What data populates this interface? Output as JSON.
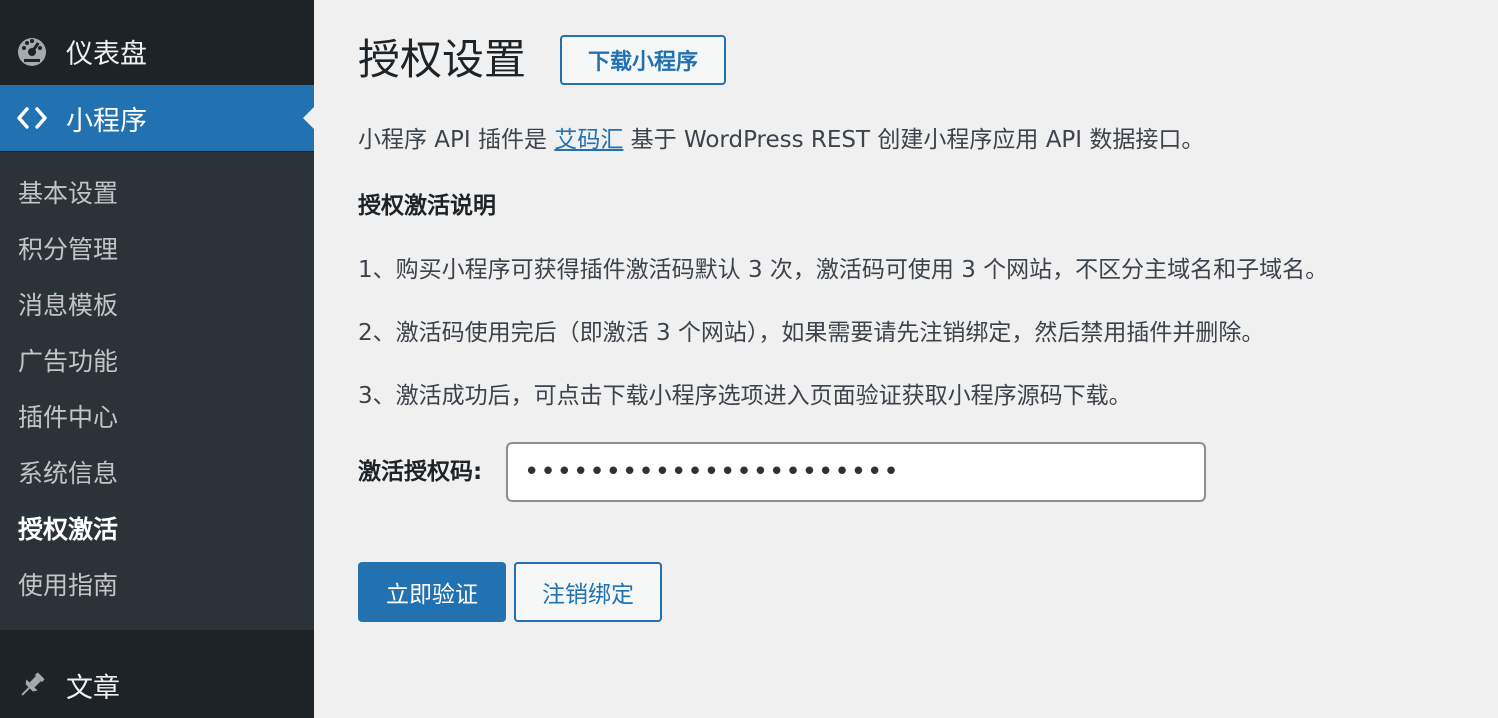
{
  "sidebar": {
    "dashboard_label": "仪表盘",
    "miniprogram_label": "小程序",
    "posts_label": "文章",
    "submenu": [
      {
        "label": "基本设置"
      },
      {
        "label": "积分管理"
      },
      {
        "label": "消息模板"
      },
      {
        "label": "广告功能"
      },
      {
        "label": "插件中心"
      },
      {
        "label": "系统信息"
      },
      {
        "label": "授权激活",
        "current": true
      },
      {
        "label": "使用指南"
      }
    ]
  },
  "header": {
    "title": "授权设置",
    "action_label": "下载小程序"
  },
  "intro": {
    "before": "小程序 API 插件是 ",
    "link": "艾码汇",
    "after": " 基于 WordPress REST 创建小程序应用 API 数据接口。"
  },
  "section_heading": "授权激活说明",
  "steps": [
    "1、购买小程序可获得插件激活码默认 3 次，激活码可使用 3 个网站，不区分主域名和子域名。",
    "2、激活码使用完后（即激活 3 个网站），如果需要请先注销绑定，然后禁用插件并删除。",
    "3、激活成功后，可点击下载小程序选项进入页面验证获取小程序源码下载。"
  ],
  "form": {
    "label": "激活授权码:",
    "value": "•••••••••••••••••••••••"
  },
  "buttons": {
    "verify": "立即验证",
    "unbind": "注销绑定"
  },
  "colors": {
    "sidebar_bg": "#1d2327",
    "submenu_bg": "#2c3338",
    "accent": "#2271b1",
    "page_bg": "#f0f0f1"
  }
}
